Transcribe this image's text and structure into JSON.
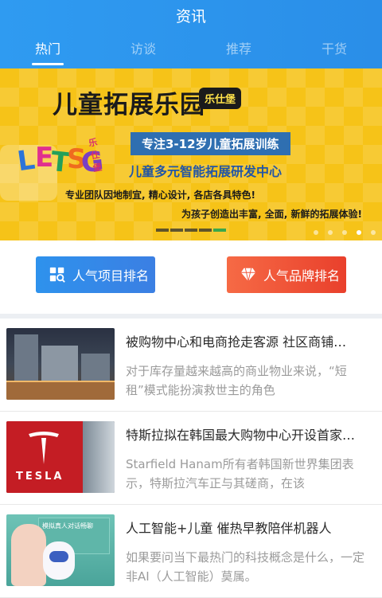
{
  "header": {
    "title": "资讯",
    "tabs": [
      {
        "label": "热门",
        "active": true
      },
      {
        "label": "访谈",
        "active": false
      },
      {
        "label": "推荐",
        "active": false
      },
      {
        "label": "干货",
        "active": false
      }
    ]
  },
  "banner": {
    "title": "儿童拓展乐园",
    "badge": "乐仕堡",
    "logo_text": {
      "l": "L",
      "e": "E",
      "t": "T",
      "s": "S",
      "g": "G",
      "cn": "乐仕堡"
    },
    "tag": "专注3-12岁儿童拓展训练",
    "line1": "儿童多元智能拓展研发中心",
    "line2": "专业团队因地制宜, 精心设计, 各店各具特色!",
    "line3": "为孩子创造出丰富, 全面, 新鲜的拓展体验!",
    "active_dot": 3
  },
  "actions": {
    "project_rank_label": "人气项目排名",
    "brand_rank_label": "人气品牌排名"
  },
  "news": [
    {
      "title": "被购物中心和电商抢走客源 社区商铺…",
      "desc": "对于库存量越来越高的商业物业来说，“短租”模式能扮演救世主的角色"
    },
    {
      "title": "特斯拉拟在韩国最大购物中心开设首家…",
      "desc": "Starfield Hanam所有者韩国新世界集团表示，特斯拉汽车正与其磋商，在该"
    },
    {
      "title": "人工智能+儿童 催热早教陪伴机器人",
      "desc": "如果要问当下最热门的科技概念是什么，一定非AI（人工智能）莫属。"
    }
  ],
  "thumb_text": {
    "tesla_word": "TESLA",
    "board_text": "模拟真人对话畅聊"
  },
  "colors": {
    "header_blue": "#2f9bf1",
    "banner_yellow": "#f6c318",
    "button_blue": "#2e92ed",
    "button_red": "#f0553a"
  }
}
